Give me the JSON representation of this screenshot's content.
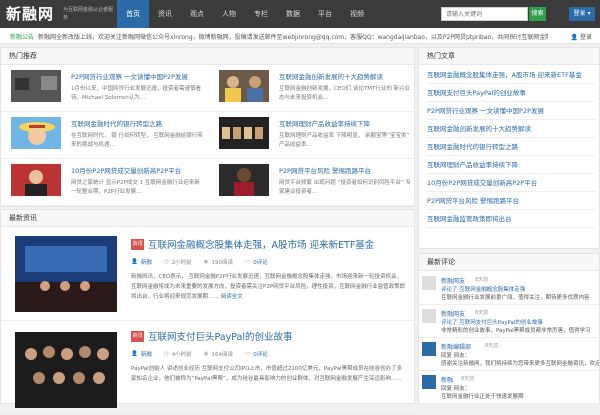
{
  "header": {
    "logo": "新融网",
    "tagline": "为互联网金融从业者服务",
    "nav": [
      "首页",
      "资讯",
      "观点",
      "人物",
      "专栏",
      "数据",
      "平台",
      "视频"
    ],
    "search_placeholder": "请输入关键词",
    "search_button": "搜索",
    "user_button": "登录 ▾"
  },
  "ticker": {
    "label": "新融公告",
    "text": "新融网全新改版上线，欢迎关注新融网微信公众号xinrong，微博新融网，投稿请发送邮件至webjinrong@qq.com，客服QQ：wangdaijianbao，以及P2P网贷ptpribao，共同探讨互联网金融未来发展hlwjrzp中心",
    "right": "登录"
  },
  "featured": {
    "heading": "热门推荐",
    "cards": [
      {
        "title": "P2P网贷行业观察 一文读懂中国P2P发展",
        "desc": "1月份以来，中国网贷行业发展迅速，投资者需谨慎看待。Michael Solomon认为…"
      },
      {
        "title": "互联网金融创新发展的十大趋势解读",
        "desc": "互联网金融创新发展，CEO们 谈论TMT行业的 新兴业态与未来投资机会…"
      },
      {
        "title": "互联网金融时代的银行转型之路",
        "desc": "在互联网时代， 银 行如何转型， 互联网金融给银行带来的挑战与机遇…"
      },
      {
        "title": "互联网理财产品收益率持续下降",
        "desc": "互联网理财产品收益率 下降明显， 余额宝等“宝宝类” 产品收益率…"
      },
      {
        "title": "10月份P2P网贷成交量创新高P2P平台",
        "desc": "网贷之家统计 显示P2P成交 1 互联网金融行业迎来新一轮整合期，P2P行业发展…"
      },
      {
        "title": "P2P网贷平台风险 警惕跑路平台",
        "desc": "网贷平台频繁 出现问题 “投资者如何识别风险平台” 专家建议投资者…"
      }
    ]
  },
  "latest": {
    "heading": "最新资讯",
    "articles": [
      {
        "badge": "资讯",
        "title": "互联网金融概念股集体走强，A股市场 迎来新ETF基金",
        "author": "新融",
        "time": "2小时前",
        "views": "190阅读",
        "comments": "0评论",
        "excerpt": "新融网讯，CEO表示， 互联网金融P2P行业发展迅速，互联网金融概念股集体走强，市场迎来新一轮投资机会，互联网金融将成为未来重要的发展方向，投资者需关注P2P网贷平台风险，理性投资，互联网金融行业监管政策即将出台，行业将迎来规范发展期……",
        "more": "阅读全文"
      },
      {
        "badge": "资讯",
        "title": "互联网支付巨头PayPal的创业故事",
        "author": "新融",
        "time": "4小时前",
        "views": "164阅读",
        "comments": "0评论",
        "excerpt": "PayPal创始人 讲述创业经历 互联网支付公司IPO上市，市值超过2100亿美元，PayPal黑帮成员在硅谷创办了多家知名企业，他们被称为“PayPal黑帮”，成为硅谷最具影响力的创业群体，对互联网金融发展产生深远影响……",
        "more": "阅读全文"
      }
    ]
  },
  "sidebar": {
    "hot_heading": "热门文章",
    "hot_items": [
      "互联网金融概念股集体走强，A股市场 迎来新ETF基金",
      "互联网支付巨头PayPal的创业故事",
      "P2P网贷行业观察 一文读懂中国P2P发展",
      "互联网金融创新发展的十大趋势解读",
      "互联网金融时代的银行转型之路",
      "互联网理财产品收益率持续下降",
      "10月份P2P网贷成交量创新高P2P平台",
      "P2P网贷平台风险 警惕跑路平台",
      "互联网金融监管政策即将出台"
    ],
    "comments_heading": "最新评论",
    "comments": [
      {
        "name": "新融网友",
        "time": "8天前",
        "line1": "评论了 互联网金融概念股集体走强",
        "line2": "互联网金融行业发展前景广阔，值得关注，期待更多优质内容"
      },
      {
        "name": "新融网友",
        "time": "8天前",
        "line1": "评论了 互联网支付巨头PayPal的创业故事",
        "line2": "非常精彩的创业故事，PayPal黑帮成员都非常厉害，值得学习"
      },
      {
        "name": "新融编辑部",
        "time": "8天前",
        "line1": "回复 网友：",
        "line2": "感谢关注新融网，我们将持续为您带来更多互联网金融资讯，欢迎订阅"
      },
      {
        "name": "新融",
        "time": "8天前",
        "line1": "回复 网友：",
        "line2": "互联网金融行业正处于快速发展期"
      }
    ]
  },
  "colors": {
    "accent": "#2a6ba8",
    "green": "#2ea24a",
    "badge": "#d9534f",
    "topbar": "#3b3b3b"
  }
}
